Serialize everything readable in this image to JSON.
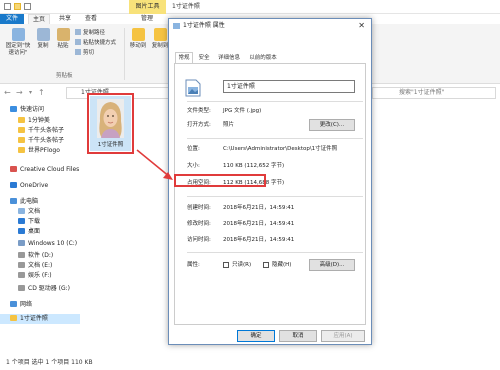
{
  "window": {
    "title": "1寸证件照",
    "contextual_tab": "图片工具",
    "tabs": [
      "文件",
      "主页",
      "共享",
      "查看",
      "管理"
    ]
  },
  "ribbon": {
    "pin_label": "固定到\"快速访问\"",
    "copy_label": "复制",
    "paste_label": "粘贴",
    "copy_path": "复制路径",
    "paste_shortcut": "粘贴快捷方式",
    "cut": "剪切",
    "clipboard_group": "剪贴板",
    "move_to": "移动到",
    "copy_to": "复制到"
  },
  "address": {
    "path": "1寸证件照",
    "search_placeholder": "搜索\"1寸证件照\""
  },
  "nav": {
    "items": [
      {
        "label": "快速访问",
        "icon": "star-icon",
        "color": "#3b8ee0"
      },
      {
        "label": "1分钟美",
        "icon": "folder-icon",
        "color": "#f5c342"
      },
      {
        "label": "千牛头条帖子",
        "icon": "folder-icon",
        "color": "#f5c342"
      },
      {
        "label": "千牛头条帖子",
        "icon": "folder-icon",
        "color": "#f5c342"
      },
      {
        "label": "世界PFlogo",
        "icon": "folder-icon",
        "color": "#f5c342"
      },
      {
        "label": "Creative Cloud Files",
        "icon": "cloud-icon",
        "color": "#d9534f"
      },
      {
        "label": "OneDrive",
        "icon": "cloud-icon",
        "color": "#2a7ad4"
      },
      {
        "label": "此电脑",
        "icon": "computer-icon",
        "color": "#4a90d9"
      },
      {
        "label": "文档",
        "icon": "document-icon",
        "color": "#8ab4e0"
      },
      {
        "label": "下载",
        "icon": "download-icon",
        "color": "#2a7ad4"
      },
      {
        "label": "桌面",
        "icon": "desktop-icon",
        "color": "#2a7ad4"
      },
      {
        "label": "Windows 10 (C:)",
        "icon": "drive-icon",
        "color": "#7a9cc6"
      },
      {
        "label": "软件 (D:)",
        "icon": "drive-icon",
        "color": "#999999"
      },
      {
        "label": "文档 (E:)",
        "icon": "drive-icon",
        "color": "#999999"
      },
      {
        "label": "娱乐 (F:)",
        "icon": "drive-icon",
        "color": "#999999"
      },
      {
        "label": "CD 驱动器 (G:)",
        "icon": "disc-icon",
        "color": "#999999"
      },
      {
        "label": "网络",
        "icon": "network-icon",
        "color": "#4a90d9"
      },
      {
        "label": "1寸证件照",
        "icon": "folder-icon",
        "color": "#f5c342"
      }
    ]
  },
  "file": {
    "name": "1寸证件照"
  },
  "status": {
    "text": "1 个项目   选中 1 个项目  110 KB"
  },
  "dialog": {
    "title": "1寸证件照 属性",
    "tabs": [
      "常规",
      "安全",
      "详细信息",
      "以前的版本"
    ],
    "filename": "1寸证件照",
    "rows": {
      "type_label": "文件类型:",
      "type_value": "JPG 文件 (.jpg)",
      "open_label": "打开方式:",
      "open_value": "照片",
      "change_btn": "更改(C)...",
      "loc_label": "位置:",
      "loc_value": "C:\\Users\\Administrator\\Desktop\\1寸证件照",
      "size_label": "大小:",
      "size_value": "110 KB (112,652 字节)",
      "disk_label": "占用空间:",
      "disk_value": "112 KB (114,688 字节)",
      "created_label": "创建时间:",
      "created_value": "2018年6月21日，14:59:41",
      "modified_label": "修改时间:",
      "modified_value": "2018年6月21日，14:59:41",
      "accessed_label": "访问时间:",
      "accessed_value": "2018年6月21日，14:59:41",
      "attr_label": "属性:",
      "readonly": "只读(R)",
      "hidden": "隐藏(H)",
      "advanced_btn": "高级(D)..."
    },
    "buttons": {
      "ok": "确定",
      "cancel": "取消",
      "apply": "应用(A)"
    }
  },
  "colors": {
    "accent": "#1979ca",
    "highlight": "#e03b3b",
    "selection": "#cce8ff"
  }
}
